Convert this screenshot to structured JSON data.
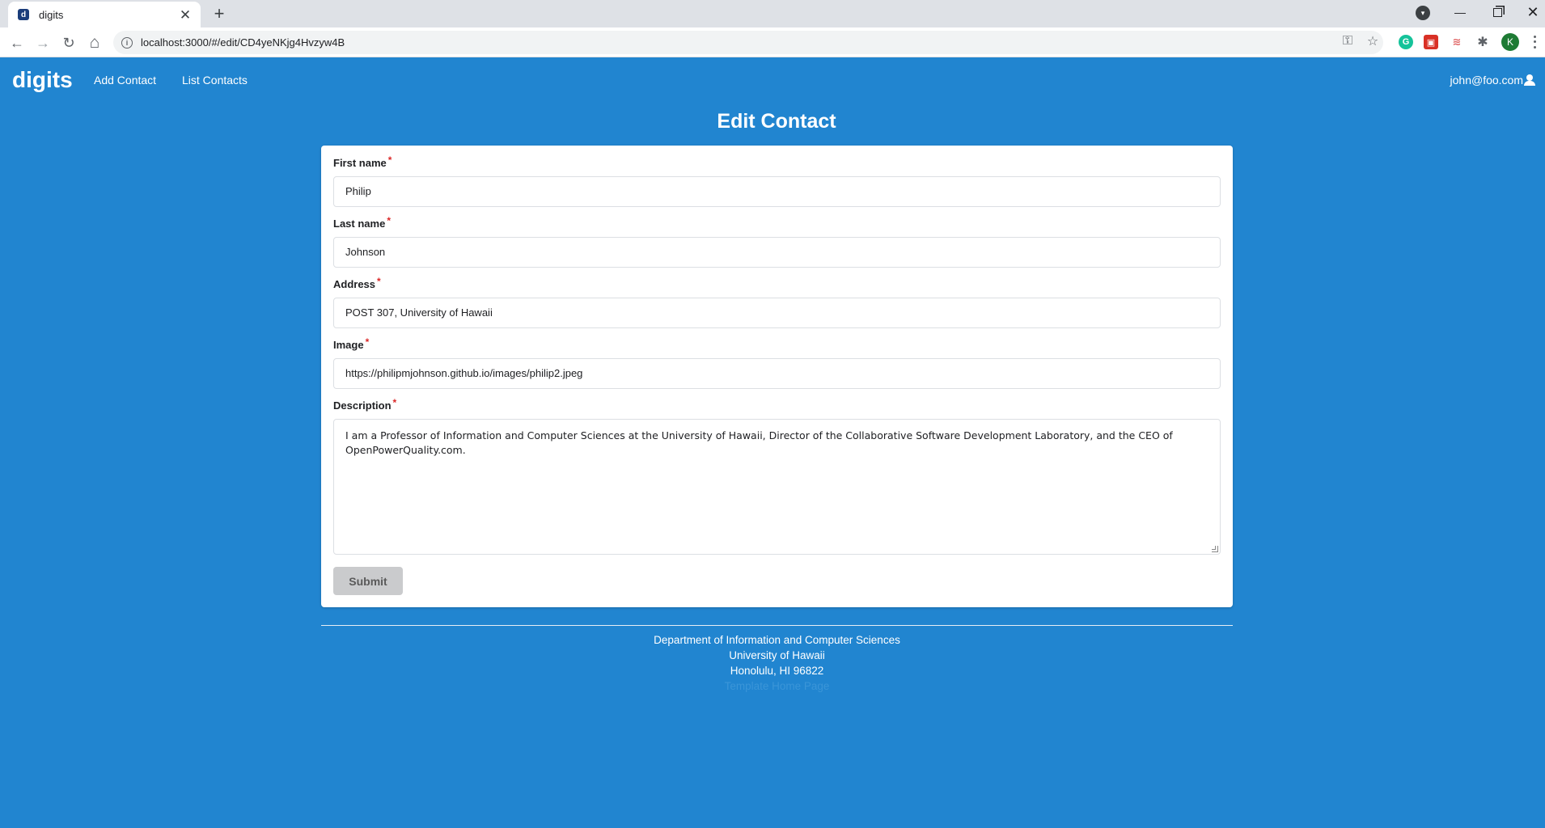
{
  "browser": {
    "tab_title": "digits",
    "tab_close": "✕",
    "new_tab": "+",
    "url": "localhost:3000/#/edit/CD4yeNKjg4Hvzyw4B",
    "profile_initial": "K"
  },
  "navbar": {
    "brand": "digits",
    "links": [
      "Add Contact",
      "List Contacts"
    ],
    "user": "john@foo.com"
  },
  "form": {
    "title": "Edit Contact",
    "required_marker": "*",
    "fields": [
      {
        "label": "First name",
        "value": "Philip"
      },
      {
        "label": "Last name",
        "value": "Johnson"
      },
      {
        "label": "Address",
        "value": "POST 307, University of Hawaii"
      },
      {
        "label": "Image",
        "value": "https://philipmjohnson.github.io/images/philip2.jpeg"
      }
    ],
    "description": {
      "label": "Description",
      "value": "I am a Professor of Information and Computer Sciences at the University of Hawaii, Director of the Collaborative Software Development Laboratory, and the CEO of OpenPowerQuality.com."
    },
    "submit_label": "Submit"
  },
  "footer": {
    "lines": [
      "Department of Information and Computer Sciences",
      "University of Hawaii",
      "Honolulu, HI 96822",
      "Template Home Page"
    ]
  },
  "colors": {
    "primary": "#2185d0",
    "required": "#db2828",
    "button": "#cacbcd"
  },
  "icons": {
    "back": "←",
    "forward": "→",
    "reload": "↻",
    "home": "⌂",
    "key": "⚿",
    "star": "☆",
    "extensions": "✱",
    "win_min": "—",
    "win_close": "✕"
  }
}
